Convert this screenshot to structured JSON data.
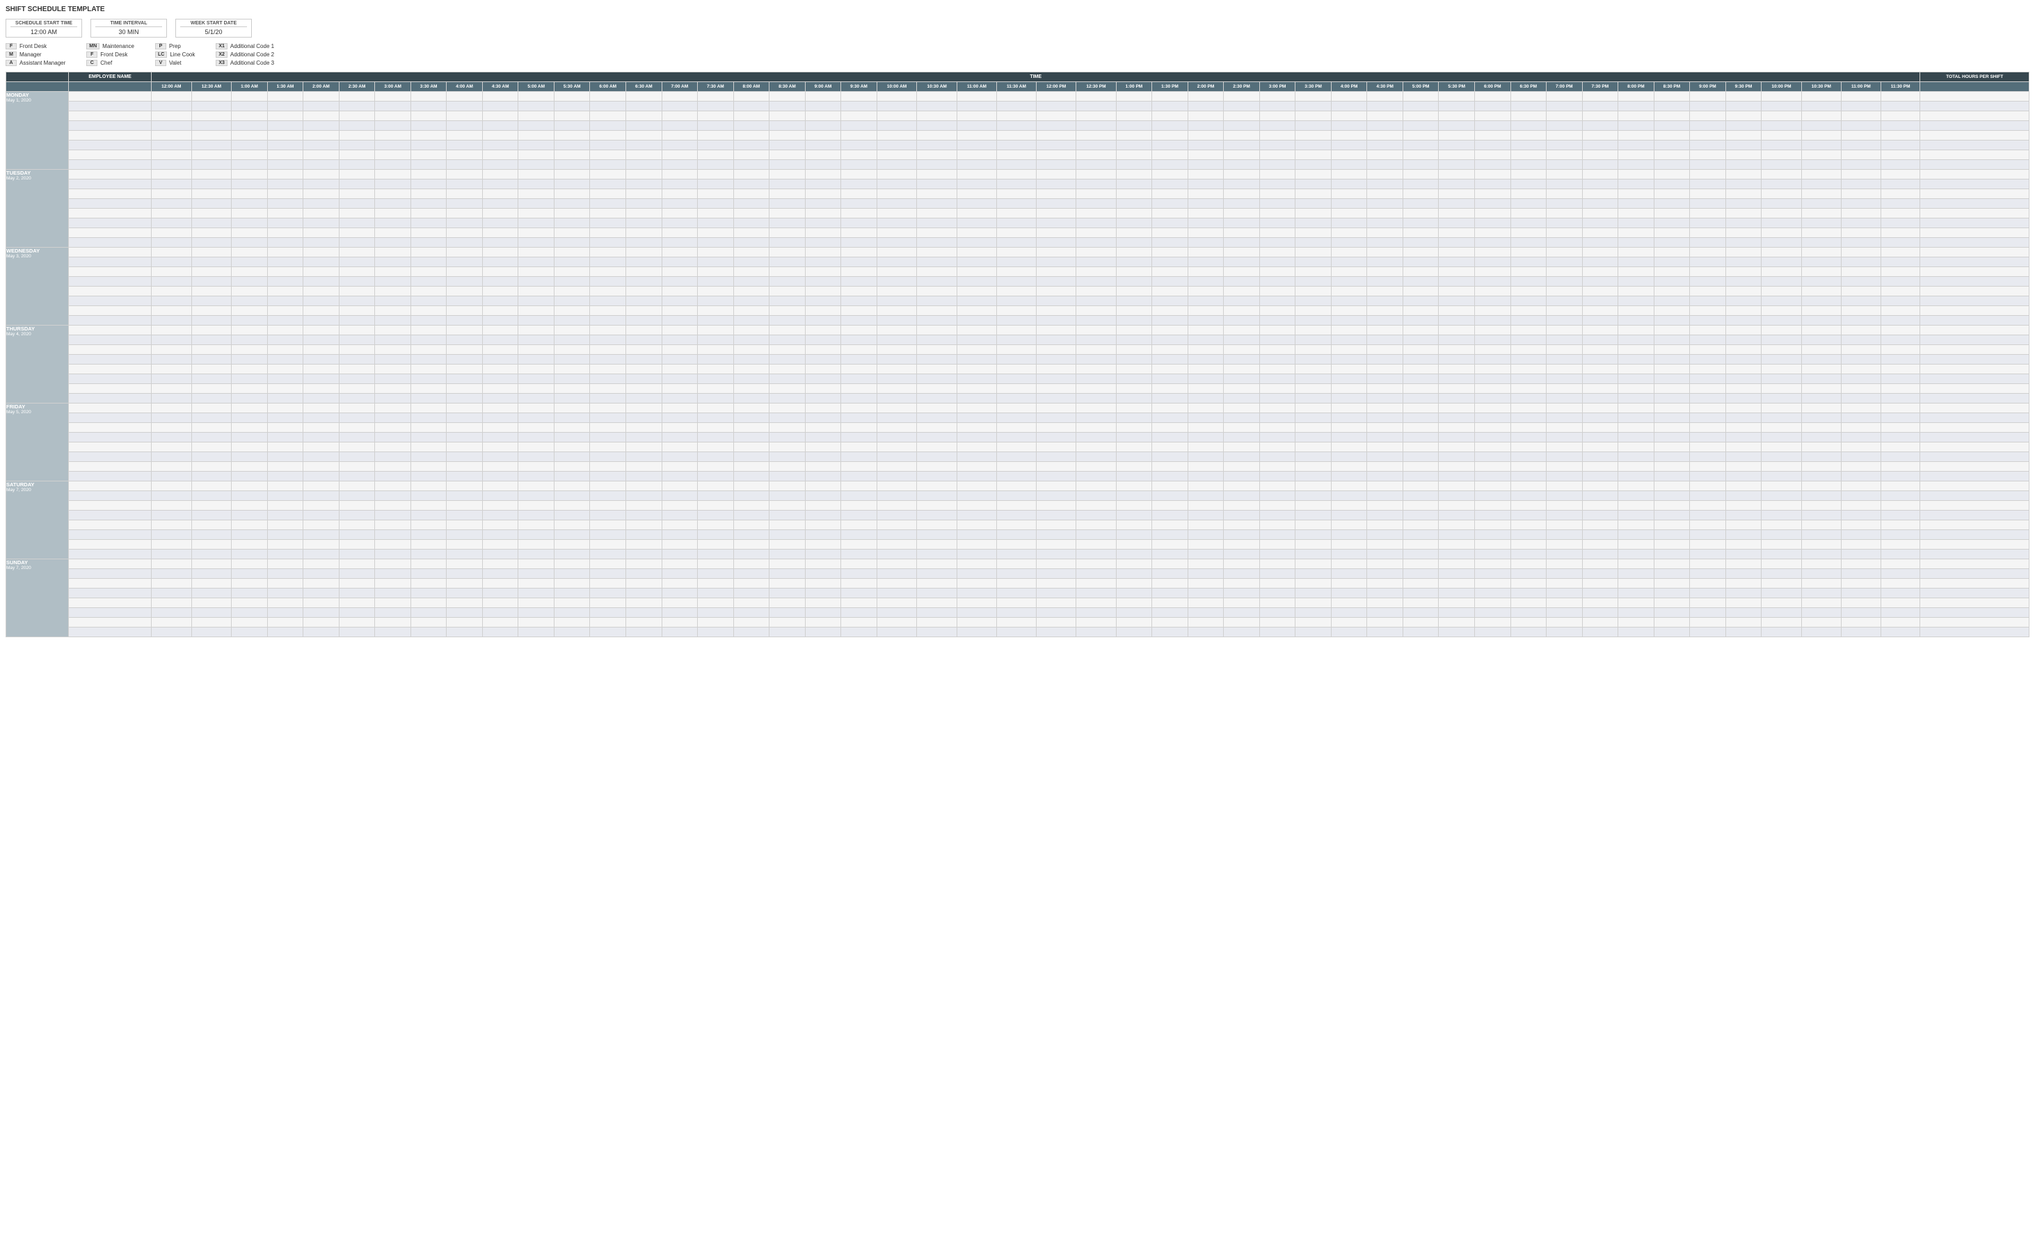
{
  "page": {
    "title": "SHIFT SCHEDULE TEMPLATE"
  },
  "config": {
    "schedule_start_time_label": "SCHEDULE START TIME",
    "schedule_start_time_value": "12:00 AM",
    "time_interval_label": "TIME INTERVAL",
    "time_interval_value": "30 MIN",
    "week_start_date_label": "WEEK START DATE",
    "week_start_date_value": "5/1/20"
  },
  "legend": [
    {
      "code": "F",
      "desc": "Front Desk"
    },
    {
      "code": "M",
      "desc": "Manager"
    },
    {
      "code": "A",
      "desc": "Assistant Manager"
    },
    {
      "code": "MN",
      "desc": "Maintenance"
    },
    {
      "code": "F",
      "desc": "Front Desk"
    },
    {
      "code": "C",
      "desc": "Chef"
    },
    {
      "code": "P",
      "desc": "Prep"
    },
    {
      "code": "LC",
      "desc": "Line Cook"
    },
    {
      "code": "V",
      "desc": "Valet"
    },
    {
      "code": "X1",
      "desc": "Additional Code 1"
    },
    {
      "code": "X2",
      "desc": "Additional Code 2"
    },
    {
      "code": "X3",
      "desc": "Additional Code 3"
    }
  ],
  "days": [
    {
      "name": "MONDAY",
      "date": "May 1, 2020",
      "rows": 8
    },
    {
      "name": "TUESDAY",
      "date": "May 2, 2020",
      "rows": 8
    },
    {
      "name": "WEDNESDAY",
      "date": "May 3, 2020",
      "rows": 8
    },
    {
      "name": "THURSDAY",
      "date": "May 4, 2020",
      "rows": 8
    },
    {
      "name": "FRIDAY",
      "date": "May 5, 2020",
      "rows": 8
    },
    {
      "name": "SATURDAY",
      "date": "May 7, 2020",
      "rows": 8
    },
    {
      "name": "SUNDAY",
      "date": "May 7, 2020",
      "rows": 8
    }
  ],
  "time_slots": [
    "12:00 AM",
    "12:30 AM",
    "1:00 AM",
    "1:30 AM",
    "2:00 AM",
    "2:30 AM",
    "3:00 AM",
    "3:30 AM",
    "4:00 AM",
    "4:30 AM",
    "5:00 AM",
    "5:30 AM",
    "6:00 AM",
    "6:30 AM",
    "7:00 AM",
    "7:30 AM",
    "8:00 AM",
    "8:30 AM",
    "9:00 AM",
    "9:30 AM",
    "10:00 AM",
    "10:30 AM",
    "11:00 AM",
    "11:30 AM",
    "12:00 PM",
    "12:30 PM",
    "1:00 PM",
    "1:30 PM",
    "2:00 PM",
    "2:30 PM",
    "3:00 PM",
    "3:30 PM",
    "4:00 PM",
    "4:30 PM",
    "5:00 PM",
    "5:30 PM",
    "6:00 PM",
    "6:30 PM",
    "7:00 PM",
    "7:30 PM",
    "8:00 PM",
    "8:30 PM",
    "9:00 PM",
    "9:30 PM",
    "10:00 PM",
    "10:30 PM",
    "11:00 PM",
    "11:30 PM"
  ],
  "headers": {
    "employee_name": "EMPLOYEE NAME",
    "time": "TIME",
    "total_hours": "TOTAL HOURS PER SHIFT"
  }
}
